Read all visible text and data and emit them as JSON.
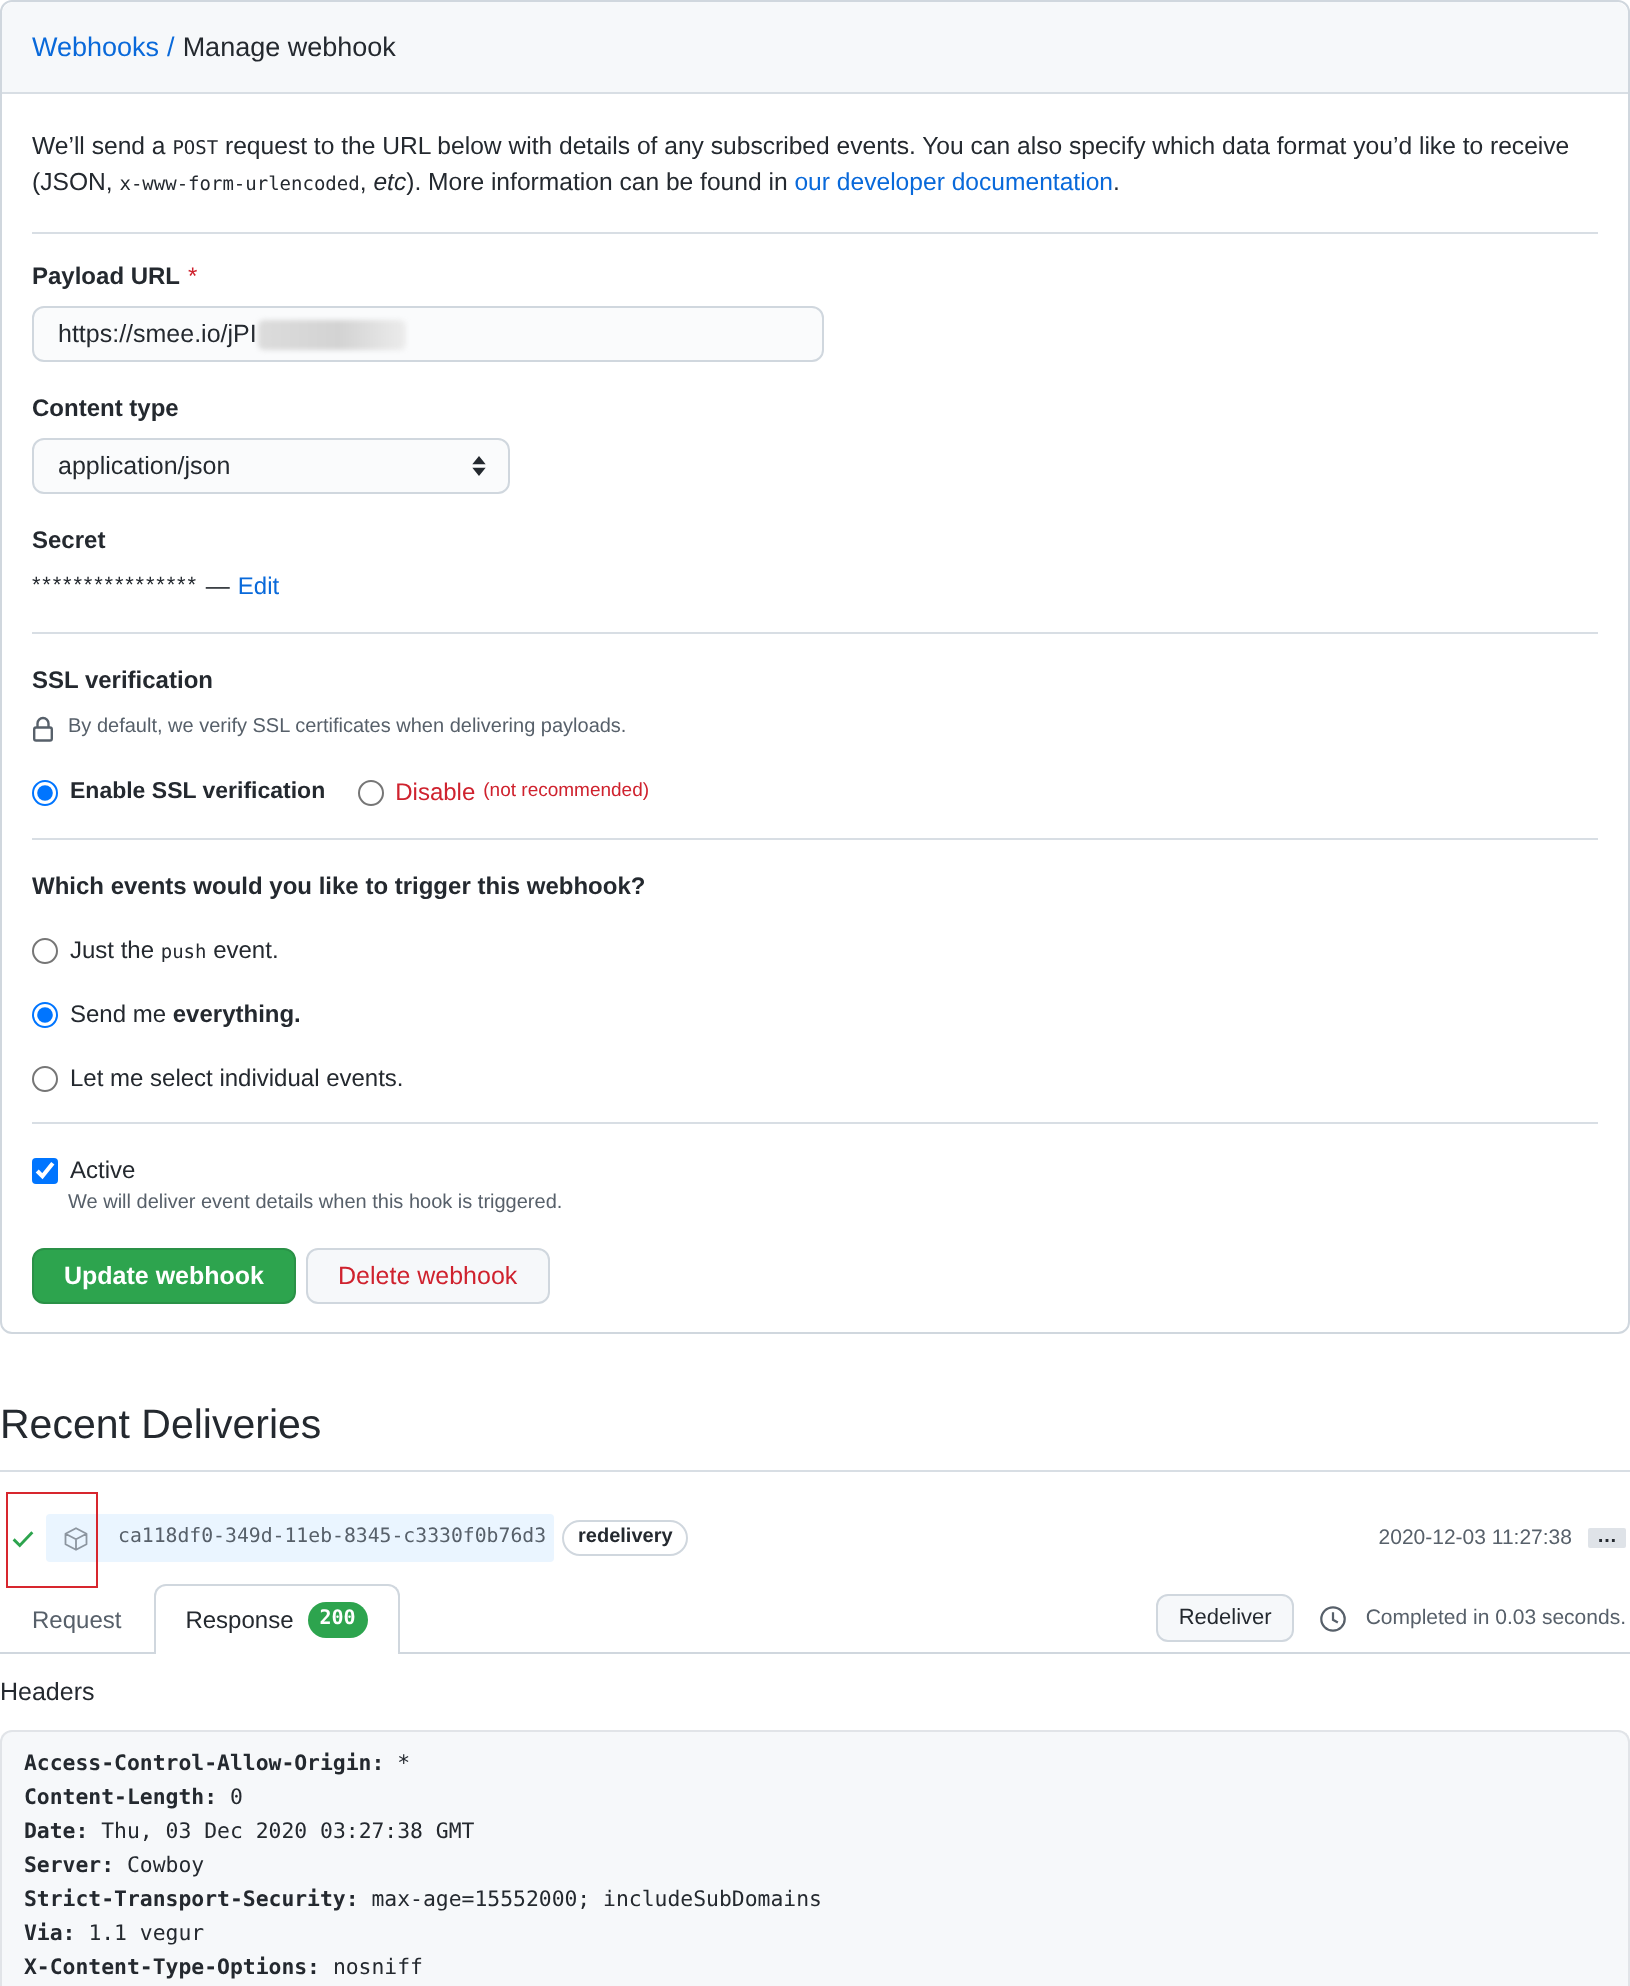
{
  "breadcrumb": {
    "parent": "Webhooks",
    "separator": "/",
    "current": "Manage webhook"
  },
  "description": [
    {
      "kind": "plain",
      "text": "We’ll send a "
    },
    {
      "kind": "code",
      "text": "POST"
    },
    {
      "kind": "plain",
      "text": " request to the URL below with details of any subscribed events. You can also specify which data format you’d like to receive (JSON, "
    },
    {
      "kind": "code",
      "text": "x-www-form-urlencoded"
    },
    {
      "kind": "plain",
      "text": ", *etc*). More information can be found in "
    },
    {
      "kind": "link",
      "text": "our developer documentation"
    },
    {
      "kind": "plain",
      "text": "."
    }
  ],
  "payload_url": {
    "label": "Payload URL",
    "required_mark": "*",
    "value": "https://smee.io/jPI",
    "redacted": true
  },
  "content_type": {
    "label": "Content type",
    "value": "application/json"
  },
  "secret": {
    "label": "Secret",
    "value": "****************",
    "separator": "—",
    "action": "Edit"
  },
  "ssl": {
    "title": "SSL verification",
    "note": "By default, we verify SSL certificates when delivering payloads.",
    "options": [
      {
        "kind": "default",
        "label": "Enable SSL verification",
        "selected": true
      },
      {
        "kind": "danger",
        "label": "Disable",
        "hint": "(not recommended)",
        "selected": false
      }
    ]
  },
  "events": {
    "title": "Which events would you like to trigger this webhook?",
    "options": [
      {
        "label": [
          {
            "kind": "plain",
            "text": "Just the "
          },
          {
            "kind": "code",
            "text": "push"
          },
          {
            "kind": "plain",
            "text": " event."
          }
        ],
        "selected": false
      },
      {
        "label": [
          {
            "kind": "plain",
            "text": "Send me **everything.**"
          }
        ],
        "selected": true
      },
      {
        "label": [
          {
            "kind": "plain",
            "text": "Let me select individual events."
          }
        ],
        "selected": false
      }
    ]
  },
  "active": {
    "label": "Active",
    "checked": true,
    "hint": "We will deliver event details when this hook is triggered."
  },
  "buttons": [
    {
      "kind": "primary",
      "label": "Update webhook"
    },
    {
      "kind": "danger",
      "label": "Delete webhook"
    }
  ],
  "recent_deliveries": {
    "title": "Recent Deliveries",
    "deliveries": [
      {
        "succeeded": true,
        "highlighted": true,
        "guid": "ca118df0-349d-11eb-8345-c3330f0b76d3",
        "tag": "redelivery",
        "time": "2020-12-03 11:27:38",
        "more": "…",
        "tabs": [
          {
            "label": "Request",
            "selected": false
          },
          {
            "label": "Response",
            "badge": "200",
            "selected": true
          }
        ],
        "redeliver": "Redeliver",
        "duration": "Completed in 0.03 seconds.",
        "headers_title": "Headers",
        "headers": [
          {
            "name": "Access-Control-Allow-Origin:",
            "value": "*"
          },
          {
            "name": "Content-Length:",
            "value": "0"
          },
          {
            "name": "Date:",
            "value": "Thu, 03 Dec 2020 03:27:38 GMT"
          },
          {
            "name": "Server:",
            "value": "Cowboy"
          },
          {
            "name": "Strict-Transport-Security:",
            "value": "max-age=15552000; includeSubDomains"
          },
          {
            "name": "Via:",
            "value": "1.1 vegur"
          },
          {
            "name": "X-Content-Type-Options:",
            "value": "nosniff"
          }
        ]
      }
    ]
  }
}
